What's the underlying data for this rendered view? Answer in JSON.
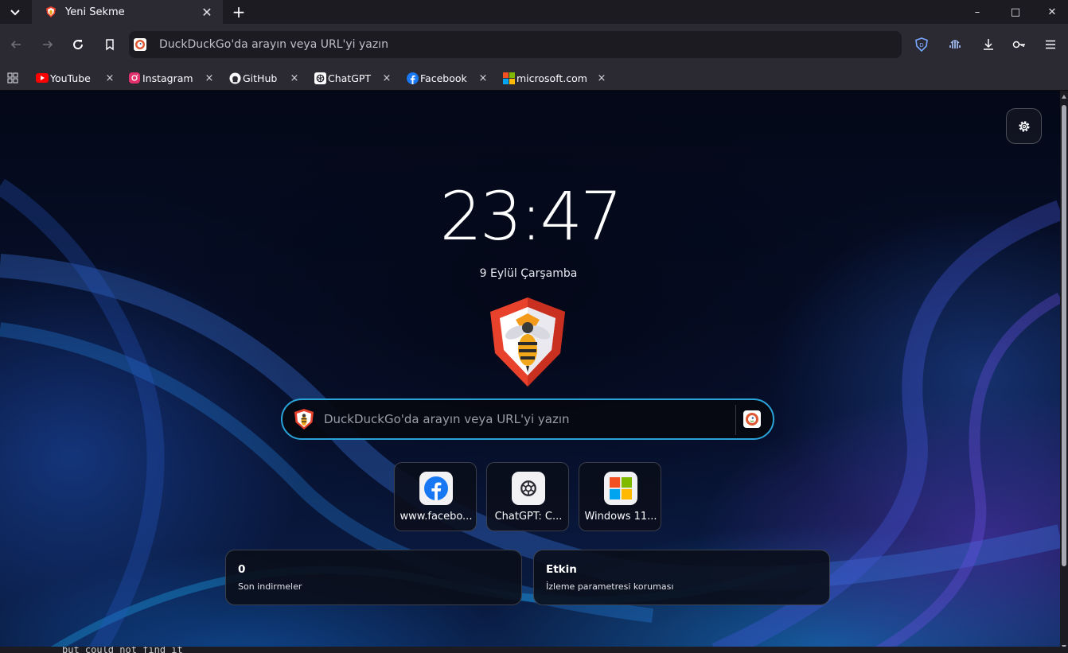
{
  "window": {
    "controls": {
      "minimize": "–",
      "maximize": "□",
      "close": "✕"
    }
  },
  "tab": {
    "title": "Yeni Sekme",
    "close_glyph": "✕",
    "new_tab_glyph": "+"
  },
  "navbar": {
    "url_placeholder": "DuckDuckGo'da arayın veya URL'yi yazın",
    "url_value": "",
    "icons": [
      "back-icon",
      "forward-icon",
      "reload-icon",
      "bookmark-icon",
      "shield-icon",
      "voice-icon",
      "download-icon",
      "key-icon",
      "menu-icon"
    ]
  },
  "bookmarks": [
    {
      "label": "YouTube",
      "icon": "youtube-icon"
    },
    {
      "label": "Instagram",
      "icon": "instagram-icon"
    },
    {
      "label": "GitHub",
      "icon": "github-icon"
    },
    {
      "label": "ChatGPT",
      "icon": "chatgpt-icon"
    },
    {
      "label": "Facebook",
      "icon": "facebook-icon"
    },
    {
      "label": "microsoft.com",
      "icon": "microsoft-icon"
    }
  ],
  "bookmark_close_glyph": "×",
  "newtab": {
    "clock": "23:47",
    "date": "9 Eylül Çarşamba",
    "search_placeholder": "DuckDuckGo'da arayın veya URL'yi yazın",
    "search_value": "",
    "tiles": [
      {
        "label": "www.facebo...",
        "icon": "facebook-icon"
      },
      {
        "label": "ChatGPT: C...",
        "icon": "chatgpt-icon"
      },
      {
        "label": "Windows 11...",
        "icon": "microsoft-icon"
      }
    ],
    "cards": [
      {
        "title": "0",
        "subtitle": "Son indirmeler"
      },
      {
        "title": "Etkin",
        "subtitle": "İzleme parametresi koruması"
      }
    ]
  },
  "terminal_text": "but could not find it",
  "colors": {
    "accent": "#2aa3d8",
    "toolbar": "#2b2a33",
    "tabstrip": "#1c1b22",
    "shield": "#7aa7ff"
  }
}
